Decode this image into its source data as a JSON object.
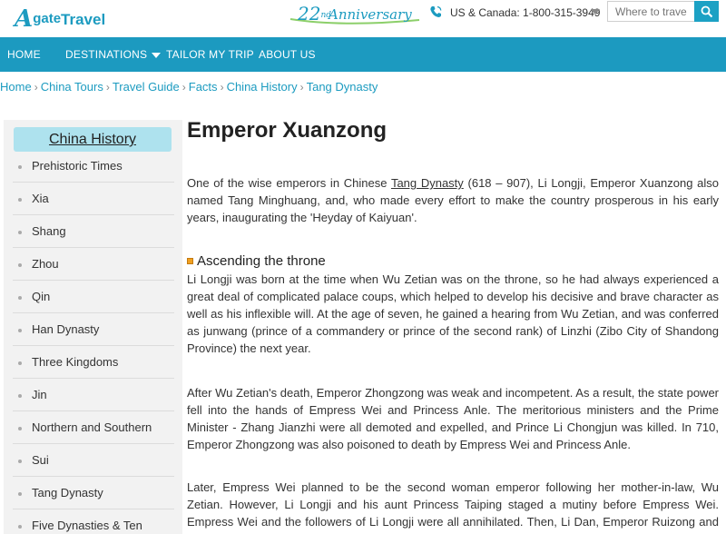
{
  "header": {
    "logo_a": "A",
    "logo_gate": "gate",
    "logo_travel": "Travel",
    "anniversary_number": "22",
    "anniversary_suffix": "nd",
    "anniversary_text": "Anniversary",
    "phone": "US & Canada: 1-800-315-3949",
    "search_placeholder": "Where to travel?"
  },
  "nav": {
    "items": [
      "HOME",
      "DESTINATIONS",
      "TAILOR MY TRIP",
      "ABOUT US"
    ]
  },
  "breadcrumb": [
    "Home",
    "China Tours",
    "Travel Guide",
    "Facts",
    "China History",
    "Tang Dynasty"
  ],
  "sidebar": {
    "title": "China History",
    "items": [
      "Prehistoric Times",
      "Xia",
      "Shang",
      "Zhou",
      "Qin",
      "Han Dynasty",
      "Three Kingdoms",
      "Jin",
      "Northern and Southern",
      "Sui",
      "Tang Dynasty",
      "Five Dynasties & Ten"
    ]
  },
  "main": {
    "title": "Emperor Xuanzong",
    "intro_before": "One of the wise emperors in Chinese ",
    "intro_link": "Tang Dynasty",
    "intro_after": " (618 – 907), Li Longji, Emperor Xuanzong also named Tang Minghuang, and, who made every effort to make the country prosperous in his early years, inaugurating the 'Heyday of Kaiyuan'.",
    "section_title": "Ascending the throne",
    "para1": "Li Longji was born at the time when Wu Zetian was on the throne, so he had always experienced a great deal of complicated palace coups, which helped to develop his decisive and brave character as well as his inflexible will. At the age of seven, he gained a hearing from Wu Zetian, and was conferred as junwang (prince of a commandery or prince of the second rank) of Linzhi (Zibo City of Shandong Province) the next year.",
    "para2": "After Wu Zetian's death, Emperor Zhongzong was weak and incompetent. As a result, the state power fell into the hands of Empress Wei and Princess Anle. The meritorious ministers and the Prime Minister - Zhang Jianzhi were all demoted and expelled, and Prince Li Chongjun was killed. In 710, Emperor Zhongzong was also poisoned to death by Empress Wei and Princess Anle.",
    "para3": "Later, Empress Wei planned to be the second woman emperor following her mother-in-law, Wu Zetian. However, Li Longji and his aunt Princess Taiping staged a mutiny before Empress Wei. Empress Wei and the followers of Li Longji were all annihilated. Then, Li Dan, Emperor Ruizong and father of Li Longji came"
  },
  "colors": {
    "brand": "#1c9bc0",
    "nav_bg": "#1c9ac0",
    "sidebar_title_bg": "#aee2ee",
    "sidebar_bg": "#f2f2f2"
  }
}
